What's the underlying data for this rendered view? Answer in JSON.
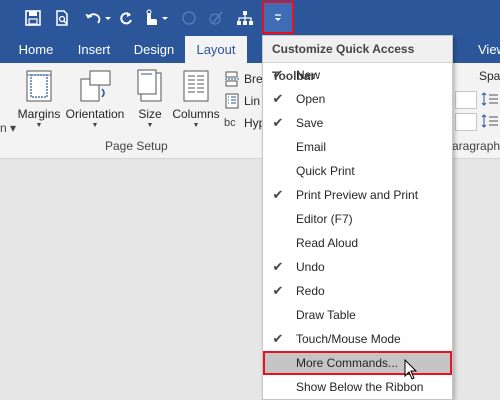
{
  "qat": {
    "icons": [
      "save-icon",
      "print-preview-icon",
      "undo-icon",
      "redo-icon",
      "touch-mode-icon",
      "draw-table-icon",
      "customize-qat-icon"
    ]
  },
  "tabs": [
    {
      "label": "Home"
    },
    {
      "label": "Insert"
    },
    {
      "label": "Design"
    },
    {
      "label": "Layout",
      "active": true
    },
    {
      "label": "View"
    }
  ],
  "ribbon": {
    "margins": "Margins",
    "orientation": "Orientation",
    "size": "Size",
    "columns": "Columns",
    "breaks": "Bre",
    "line_numbers": "Lin",
    "hyphenation": "Hyp",
    "hyphen_icon_text": "bc",
    "page_setup": "Page Setup",
    "spacing": "Spac",
    "paragraph": "aragraph"
  },
  "menu": {
    "title": "Customize Quick Access Toolbar",
    "items": [
      {
        "label": "New",
        "checked": true
      },
      {
        "label": "Open",
        "checked": true
      },
      {
        "label": "Save",
        "checked": true
      },
      {
        "label": "Email",
        "checked": false
      },
      {
        "label": "Quick Print",
        "checked": false
      },
      {
        "label": "Print Preview and Print",
        "checked": true
      },
      {
        "label": "Editor (F7)",
        "checked": false
      },
      {
        "label": "Read Aloud",
        "checked": false
      },
      {
        "label": "Undo",
        "checked": true
      },
      {
        "label": "Redo",
        "checked": true
      },
      {
        "label": "Draw Table",
        "checked": false
      },
      {
        "label": "Touch/Mouse Mode",
        "checked": true
      },
      {
        "label": "More Commands...",
        "checked": false,
        "highlighted": true
      },
      {
        "label": "Show Below the Ribbon",
        "checked": false
      }
    ],
    "check_glyph": "✔"
  },
  "colors": {
    "accent": "#2b579a",
    "highlight_border": "#e81123"
  }
}
